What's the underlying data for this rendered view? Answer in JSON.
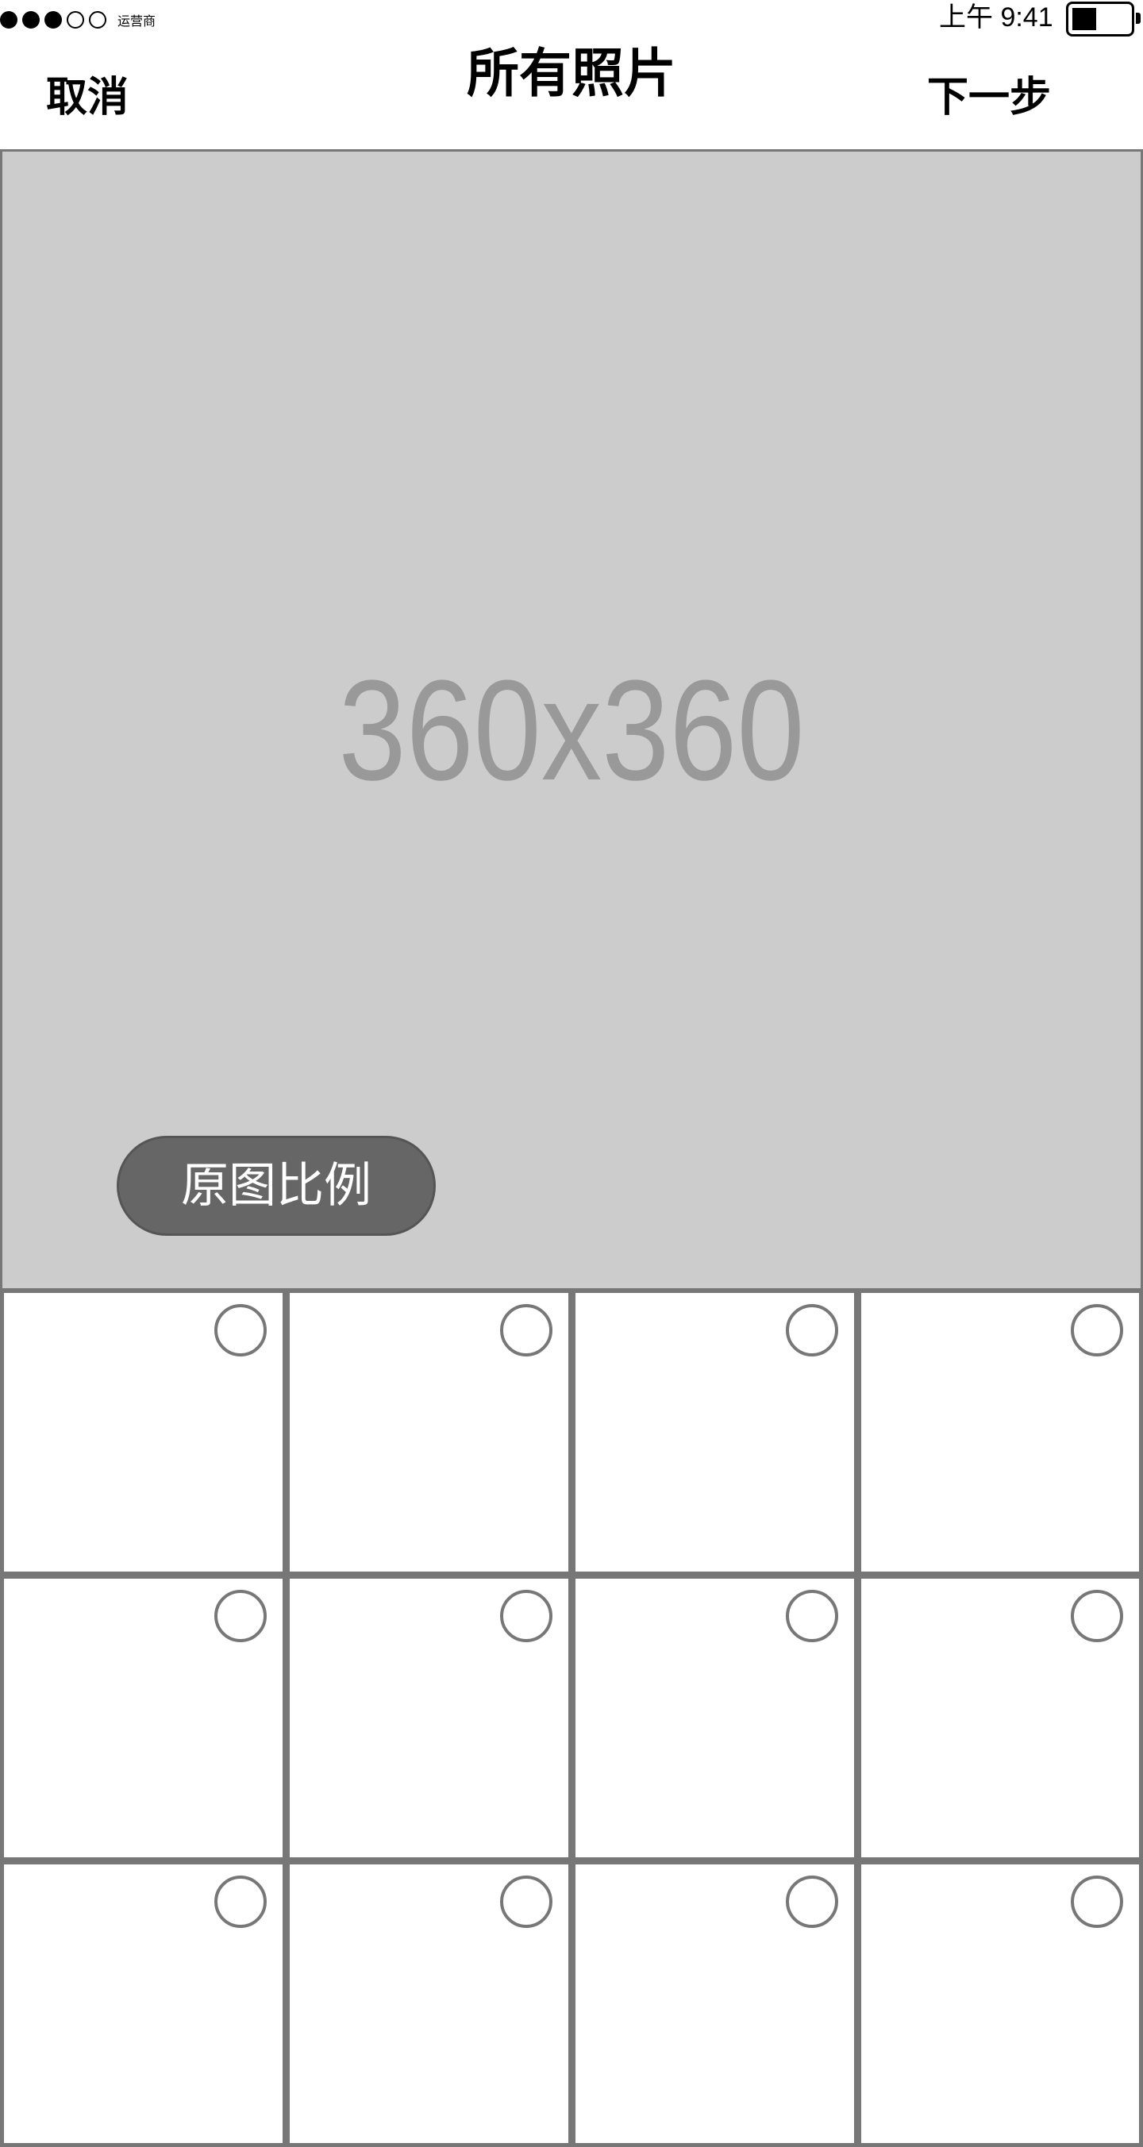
{
  "status_bar": {
    "carrier": "运营商",
    "signal_strength": 3,
    "signal_max": 5,
    "time": "上午 9:41",
    "battery_level": 0.4
  },
  "nav": {
    "cancel_label": "取消",
    "title": "所有照片",
    "next_label": "下一步"
  },
  "preview": {
    "placeholder_text": "360x360",
    "ratio_button_label": "原图比例",
    "background_color": "#cccccc"
  },
  "grid": {
    "columns": 4,
    "visible_rows": 3,
    "cells": [
      {
        "selected": false
      },
      {
        "selected": false
      },
      {
        "selected": false
      },
      {
        "selected": false
      },
      {
        "selected": false
      },
      {
        "selected": false
      },
      {
        "selected": false
      },
      {
        "selected": false
      },
      {
        "selected": false
      },
      {
        "selected": false
      },
      {
        "selected": false
      },
      {
        "selected": false
      }
    ]
  },
  "colors": {
    "border": "#777777",
    "button_bg": "#666666",
    "placeholder_text": "#999999"
  }
}
